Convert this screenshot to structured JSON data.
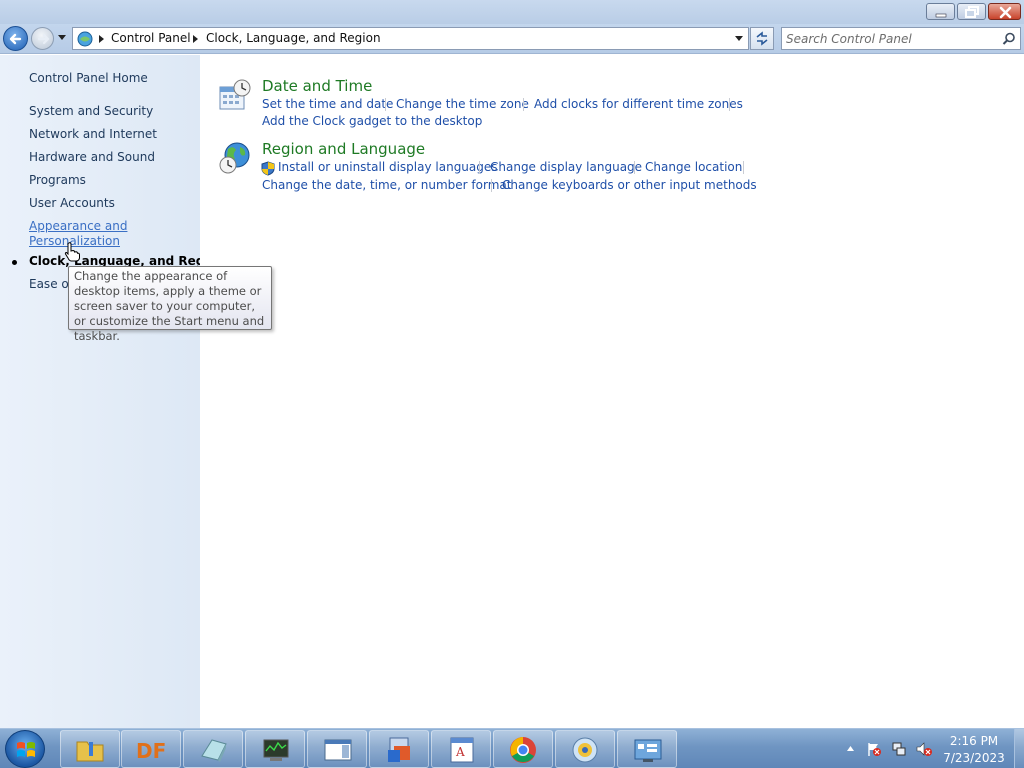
{
  "window": {
    "minimize_icon": "minimize-icon",
    "maximize_icon": "restore-icon",
    "close_icon": "close-icon"
  },
  "addressbar": {
    "crumbs": [
      "Control Panel",
      "Clock, Language, and Region"
    ],
    "search_placeholder": "Search Control Panel"
  },
  "sidebar": {
    "home": "Control Panel Home",
    "items": [
      "System and Security",
      "Network and Internet",
      "Hardware and Sound",
      "Programs",
      "User Accounts",
      "Appearance and Personalization",
      "Clock, Language, and Region",
      "Ease of Access"
    ],
    "appearance_line1": "Appearance and",
    "appearance_line2": "Personalization",
    "current": "Clock, Language, and Region",
    "ease_partial": "Ease of"
  },
  "tooltip": {
    "text": "Change the appearance of desktop items, apply a theme or screen saver to your computer, or customize the Start menu and taskbar."
  },
  "categories": [
    {
      "title": "Date and Time",
      "tasks": [
        "Set the time and date",
        "Change the time zone",
        "Add clocks for different time zones",
        "Add the Clock gadget to the desktop"
      ]
    },
    {
      "title": "Region and Language",
      "tasks": [
        "Install or uninstall display languages",
        "Change display language",
        "Change location",
        "Change the date, time, or number format",
        "Change keyboards or other input methods"
      ]
    }
  ],
  "taskbar": {
    "apps": [
      "explorer",
      "df-app",
      "notepad-app",
      "monitor-app",
      "window-app",
      "installer-app",
      "wordpad-app",
      "chrome",
      "media-disc",
      "control-panel"
    ],
    "time": "2:16 PM",
    "date": "7/23/2023"
  },
  "colors": {
    "link": "#1f4fa8",
    "category_title": "#1e7a24",
    "sidebar_link": "#1e395b"
  }
}
